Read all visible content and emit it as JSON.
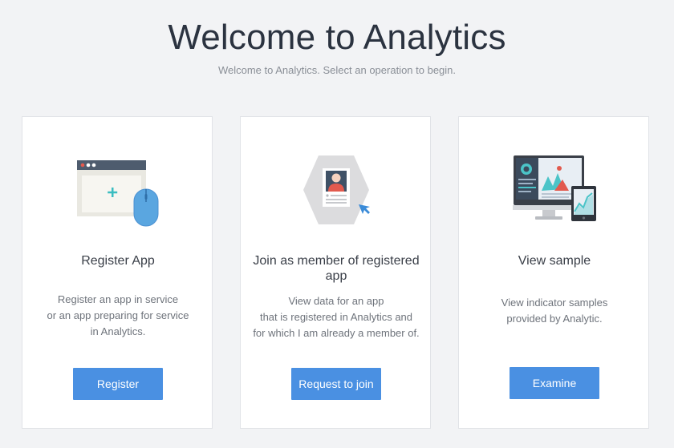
{
  "header": {
    "title": "Welcome to Analytics",
    "subtitle": "Welcome to Analytics. Select an operation to begin."
  },
  "cards": [
    {
      "icon": "browser-window-add-icon",
      "title": "Register App",
      "description": [
        "Register an app in service",
        "or an app preparing for service",
        "in Analytics."
      ],
      "button": "Register"
    },
    {
      "icon": "member-profile-icon",
      "title": "Join as member of registered app",
      "description": [
        "View data for an app",
        "that is registered in Analytics and",
        "for which I am already a member of."
      ],
      "button": "Request to join"
    },
    {
      "icon": "dashboard-devices-icon",
      "title": "View sample",
      "description": [
        "View indicator samples",
        "provided by Analytic."
      ],
      "button": "Examine"
    }
  ],
  "colors": {
    "accent": "#4a90e2",
    "background": "#f2f3f5",
    "card": "#ffffff"
  }
}
